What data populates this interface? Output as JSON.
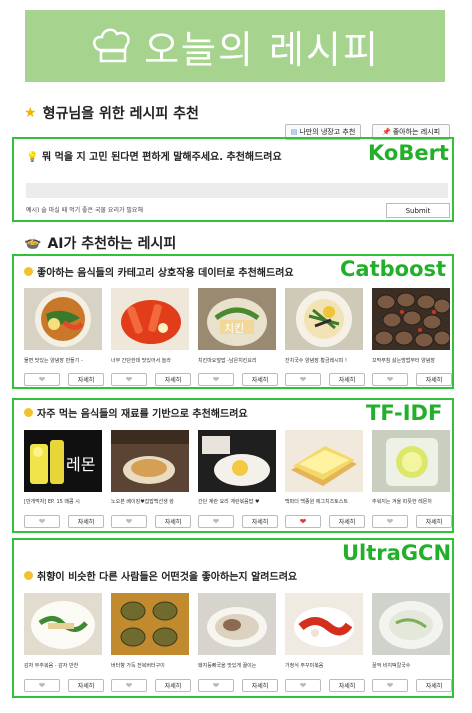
{
  "banner": {
    "title": "오늘의 레시피"
  },
  "recommend_heading": "형규님을 위한 레시피 추천",
  "top_buttons": [
    {
      "label": "나만의 냉장고 추천",
      "icon": "fridge-icon"
    },
    {
      "label": "좋아하는 레시피",
      "icon": "pin-icon"
    }
  ],
  "kobert": {
    "tag": "KoBert",
    "prompt": "뭐 먹을 지 고민 된다면 편하게 말해주세요. 추천해드려요",
    "input_value": "",
    "hint": "예시) 술 마실 때 먹기 좋은 국물 요리가 필요해",
    "submit": "Submit"
  },
  "ai_heading": "AI가 추천하는 레시피",
  "sections": [
    {
      "tag": "Catboost",
      "title": "좋아하는 음식들의 카테고리 상호작용 데이터로 추천해드려요",
      "cards": [
        {
          "caption": "물면 맛있는 양념장 만들기 -",
          "liked": false,
          "detail": "자세히"
        },
        {
          "caption": "너무 간단한데 맛있어서 놀라",
          "liked": false,
          "detail": "자세히"
        },
        {
          "caption": "치킨마요덮밥 -남은치킨요리",
          "liked": false,
          "detail": "자세히"
        },
        {
          "caption": "잔치국수 양념장 황금레시피 !",
          "liked": false,
          "detail": "자세히"
        },
        {
          "caption": "꼬막무침 삶는방법부터 양념장",
          "liked": false,
          "detail": "자세히"
        }
      ]
    },
    {
      "tag": "TF-IDF",
      "title": "자주 먹는 음식들의 재료를 기반으로 추천해드려요",
      "cards": [
        {
          "caption": "[만개먹자] EP. 15 매콤 시",
          "liked": false,
          "detail": "자세히",
          "overlay": "레몬"
        },
        {
          "caption": "노오븐 베이킹♥집밥백선생 캉",
          "liked": false,
          "detail": "자세히"
        },
        {
          "caption": "간단 계란 요리 계란볶음밥 ♥",
          "liked": false,
          "detail": "자세히"
        },
        {
          "caption": "백파더 백종원 에그치즈토스트",
          "liked": true,
          "detail": "자세히"
        },
        {
          "caption": "추워지는 겨울 따뜻한 레몬차",
          "liked": false,
          "detail": "자세히"
        }
      ]
    },
    {
      "tag": "UltraGCN",
      "title": "취향이 비슷한 다른 사람들은 어떤것을 좋아하는지 알려드려요",
      "cards": [
        {
          "caption": "감자 부추볶음 - 감자 반찬",
          "liked": false,
          "detail": "자세히"
        },
        {
          "caption": "버터향 가득 전복버터구이",
          "liked": false,
          "detail": "자세히"
        },
        {
          "caption": "돼지등뼈국을 맛있게 끓이는",
          "liked": false,
          "detail": "자세히"
        },
        {
          "caption": "가정식 주꾸미볶음",
          "liked": false,
          "detail": "자세히"
        },
        {
          "caption": "꿀꺽 비지떡칼국수",
          "liked": false,
          "detail": "자세히"
        }
      ]
    }
  ],
  "colors": {
    "banner": "#a6d48f",
    "box_border": "#31c23a",
    "tag_text": "#22b02a"
  }
}
